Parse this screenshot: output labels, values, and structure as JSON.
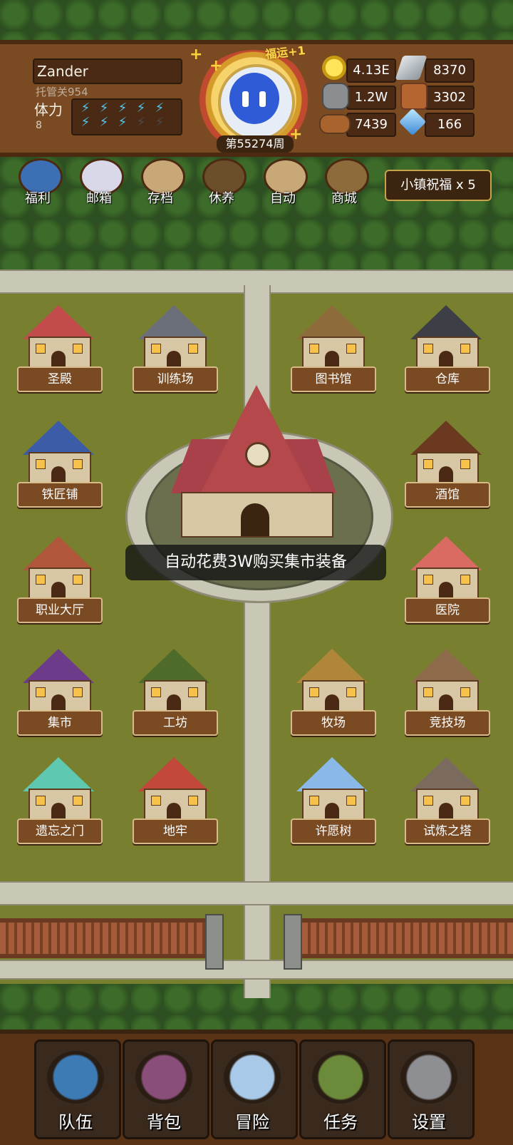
{
  "header": {
    "player_name": "Zander",
    "sub_label": "托管关954",
    "stamina_label": "体力",
    "stamina_value": "8",
    "stamina_bolts_filled": 8,
    "stamina_bolts_total": 10,
    "lucky_badge": "福运+1",
    "week_label": "第55274周"
  },
  "resources": [
    {
      "icon": "gold-coin-icon",
      "value": "4.13E"
    },
    {
      "icon": "iron-ingot-icon",
      "value": "8370"
    },
    {
      "icon": "stone-ore-icon",
      "value": "1.2W"
    },
    {
      "icon": "leather-icon",
      "value": "3302"
    },
    {
      "icon": "wood-log-icon",
      "value": "7439"
    },
    {
      "icon": "crystal-icon",
      "value": "166"
    }
  ],
  "menu": [
    {
      "icon": "welfare-shield-icon",
      "label": "福利"
    },
    {
      "icon": "mailbox-icon",
      "label": "邮箱"
    },
    {
      "icon": "save-scroll-icon",
      "label": "存档"
    },
    {
      "icon": "rest-bed-icon",
      "label": "休养"
    },
    {
      "icon": "auto-map-icon",
      "label": "自动"
    },
    {
      "icon": "shop-bag-icon",
      "label": "商城"
    }
  ],
  "blessing_label": "小镇祝福 x 5",
  "buildings": {
    "sanctuary": "圣殿",
    "training_ground": "训练场",
    "library": "图书馆",
    "warehouse": "仓库",
    "blacksmith": "铁匠铺",
    "tavern": "酒馆",
    "class_hall": "职业大厅",
    "hospital": "医院",
    "market": "集市",
    "workshop": "工坊",
    "ranch": "牧场",
    "arena": "竞技场",
    "gate_of_oblivion": "遗忘之门",
    "dungeon": "地牢",
    "wishing_tree": "许愿树",
    "trial_tower": "试炼之塔"
  },
  "toast": "自动花费3W购买集市装备",
  "bottom_tabs": [
    {
      "icon": "team-helmet-icon",
      "label": "队伍"
    },
    {
      "icon": "backpack-icon",
      "label": "背包"
    },
    {
      "icon": "crossed-swords-icon",
      "label": "冒险"
    },
    {
      "icon": "quest-scroll-icon",
      "label": "任务"
    },
    {
      "icon": "gear-icon",
      "label": "设置"
    }
  ],
  "colors": {
    "panel_brown": "#7a4a22",
    "stamina_bolt": "#4fc8f4",
    "grass": "#78802f",
    "path": "#c9c7b5"
  }
}
